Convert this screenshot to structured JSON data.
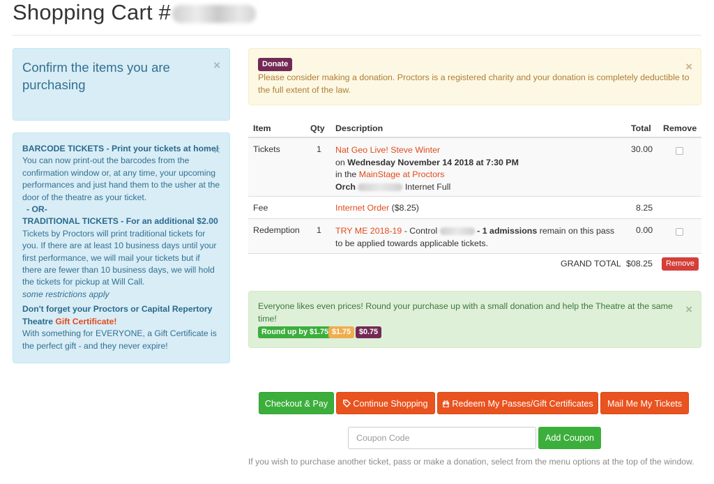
{
  "header": {
    "title": "Shopping Cart #"
  },
  "confirm_panel": {
    "text": "Confirm the items you are purchasing",
    "close": "×"
  },
  "info_panel": {
    "close": "×",
    "barcode_heading": "BARCODE TICKETS - Print your tickets at home!",
    "barcode_body": "You can now print-out the barcodes from the confirmation window or, at any time, your upcoming performances and just hand them to the usher at the door of the theatre as your ticket.",
    "or_label": "- OR-",
    "traditional_heading": "TRADITIONAL TICKETS - For an additional $2.00",
    "traditional_body": "Tickets by Proctors will print traditional tickets for you. If there are at least 10 business days until your first performance, we will mail your tickets but if there are fewer than 10 business days, we will hold the tickets for pickup at Will Call.",
    "restrictions": "some restrictions apply",
    "gift_heading": "Don't forget your Proctors or Capital Repertory Theatre",
    "gift_link": "Gift Certificate!",
    "gift_body": "With something for EVERYONE, a Gift Certificate is the perfect gift - and they never expire!"
  },
  "donate_alert": {
    "badge": "Donate",
    "text": "Please consider making a donation. Proctors is a registered charity and your donation is completely deductible to the full extent of the law.",
    "close": "×"
  },
  "cart": {
    "headers": {
      "item": "Item",
      "qty": "Qty",
      "description": "Description",
      "total": "Total",
      "remove": "Remove"
    },
    "tickets": {
      "item": "Tickets",
      "qty": "1",
      "event": "Nat Geo Live! Steve Winter",
      "on": "on",
      "date": "Wednesday November 14 2018 at 7:30 PM",
      "in_the": "in the",
      "venue": "MainStage at Proctors",
      "seat_prefix": "Orch",
      "seat_suffix": "Internet Full",
      "total": "30.00"
    },
    "fee": {
      "item": "Fee",
      "link": "Internet Order",
      "amount": "($8.25)",
      "total": "8.25"
    },
    "redemption": {
      "item": "Redemption",
      "qty": "1",
      "link": "TRY ME 2018-19",
      "control": "- Control",
      "admissions": "- 1 admissions",
      "rest": "remain on this pass to be applied towards applicable tickets.",
      "total": "0.00"
    },
    "grand_total_label": "GRAND TOTAL",
    "grand_total": "$08.25",
    "remove_button": "Remove"
  },
  "round_alert": {
    "text": "Everyone likes even prices!  Round your purchase up with a small donation and help the Theatre at the same time!",
    "close": "×",
    "options": [
      "Round up by $1.75",
      "$1.75",
      "$0.75"
    ]
  },
  "actions": {
    "checkout": "Checkout & Pay",
    "continue": "Continue Shopping",
    "redeem": "Redeem My Passes/Gift Certificates",
    "mail": "Mail Me My Tickets"
  },
  "coupon": {
    "placeholder": "Coupon Code",
    "button": "Add Coupon"
  },
  "footer": {
    "note": "If you wish to purchase another ticket, pass or make a donation, select from the menu options at the top of the window."
  },
  "colors": {
    "accent_link": "#e14a1c",
    "success": "#3cae3c",
    "danger": "#d43f3a",
    "donate": "#722a54",
    "warning_badge": "#f0ad4e"
  },
  "icons": {
    "continue": "tag-icon",
    "redeem": "gift-icon"
  }
}
